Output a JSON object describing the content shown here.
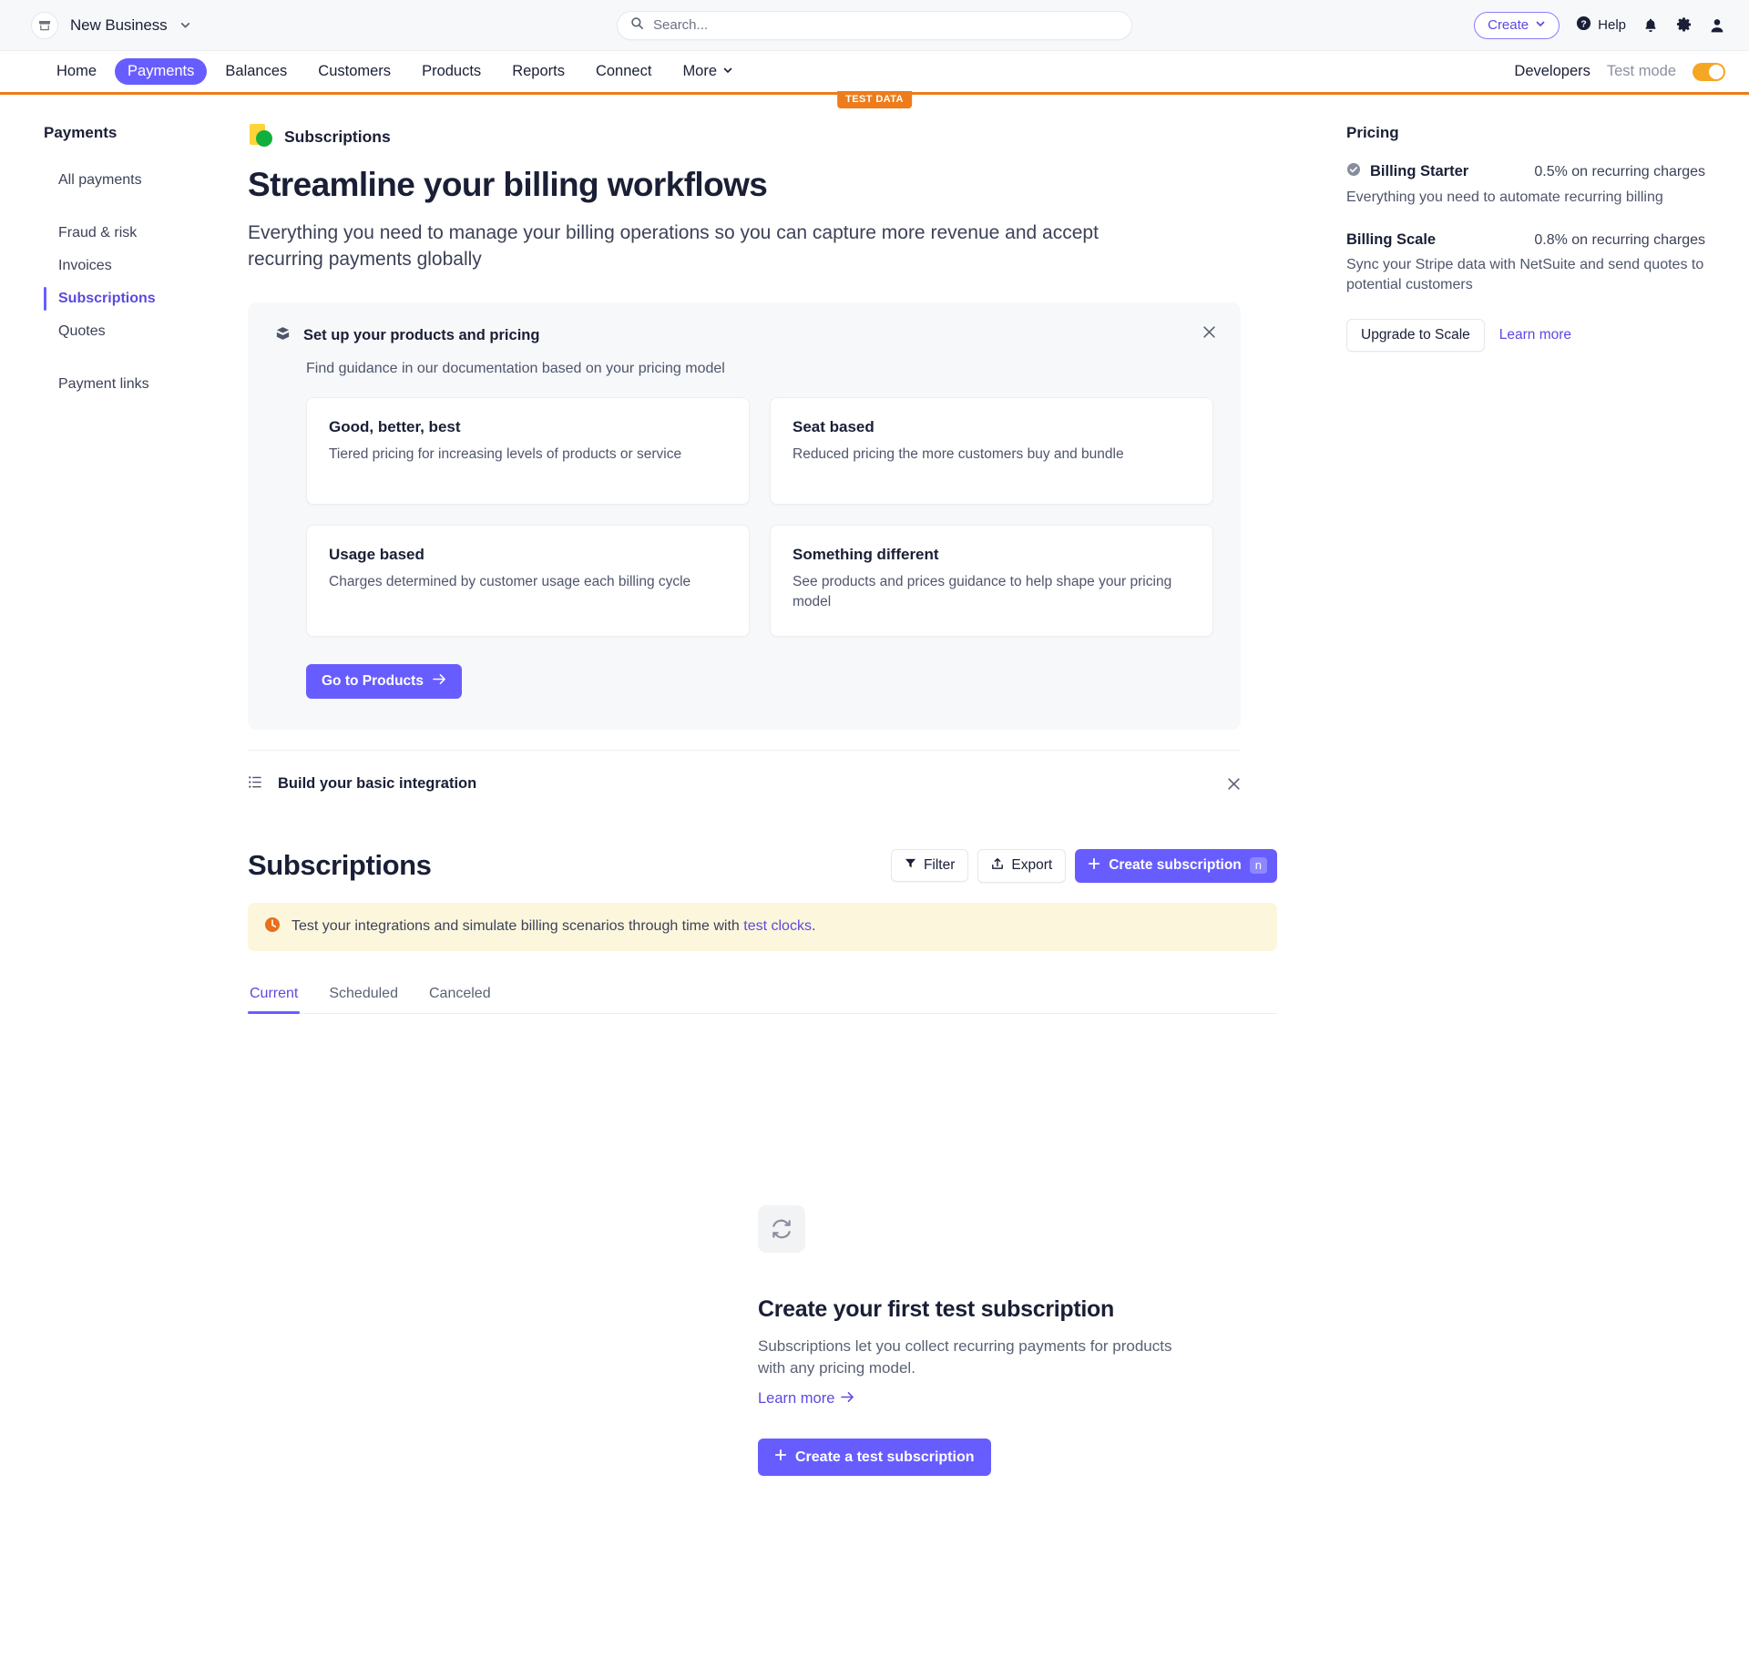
{
  "topbar": {
    "account_name": "New Business",
    "search_placeholder": "Search...",
    "search_value": "",
    "create_label": "Create",
    "help_label": "Help"
  },
  "nav": {
    "items": [
      {
        "label": "Home",
        "active": false
      },
      {
        "label": "Payments",
        "active": true
      },
      {
        "label": "Balances",
        "active": false
      },
      {
        "label": "Customers",
        "active": false
      },
      {
        "label": "Products",
        "active": false
      },
      {
        "label": "Reports",
        "active": false
      },
      {
        "label": "Connect",
        "active": false
      },
      {
        "label": "More",
        "active": false
      }
    ],
    "developers_label": "Developers",
    "test_mode_label": "Test mode",
    "test_data_badge": "TEST DATA",
    "accent_orange": "#ee7c1b",
    "accent_purple": "#675dff"
  },
  "sidebar": {
    "title": "Payments",
    "items": [
      {
        "label": "All payments",
        "active": false
      },
      {
        "label": "Fraud & risk",
        "active": false
      },
      {
        "label": "Invoices",
        "active": false
      },
      {
        "label": "Subscriptions",
        "active": true
      },
      {
        "label": "Quotes",
        "active": false
      },
      {
        "label": "Payment links",
        "active": false
      }
    ]
  },
  "hero": {
    "eyebrow": "Subscriptions",
    "title": "Streamline your billing workflows",
    "subtitle": "Everything you need to manage your billing operations so you can capture more revenue and accept recurring payments globally"
  },
  "setup_panel": {
    "title": "Set up your products and pricing",
    "subtitle": "Find guidance in our documentation based on your pricing model",
    "cards": [
      {
        "title": "Good, better, best",
        "desc": "Tiered pricing for increasing levels of products or service"
      },
      {
        "title": "Seat based",
        "desc": "Reduced pricing the more customers buy and bundle"
      },
      {
        "title": "Usage based",
        "desc": "Charges determined by customer usage each billing cycle"
      },
      {
        "title": "Something different",
        "desc": "See products and prices guidance to help shape your pricing model"
      }
    ],
    "cta_label": "Go to Products"
  },
  "build_row": {
    "title": "Build your basic integration"
  },
  "subscriptions": {
    "heading": "Subscriptions",
    "filter_label": "Filter",
    "export_label": "Export",
    "create_label": "Create subscription",
    "create_shortcut": "n",
    "notice_text_before": "Test your integrations and simulate billing scenarios through time with ",
    "notice_link": "test clocks",
    "notice_text_after": ".",
    "tabs": [
      {
        "label": "Current",
        "active": true
      },
      {
        "label": "Scheduled",
        "active": false
      },
      {
        "label": "Canceled",
        "active": false
      }
    ]
  },
  "empty_state": {
    "title": "Create your first test subscription",
    "desc": "Subscriptions let you collect recurring payments for products with any pricing model.",
    "learn_more": "Learn more",
    "cta_label": "Create a test subscription"
  },
  "pricing_rail": {
    "title": "Pricing",
    "plans": [
      {
        "name": "Billing Starter",
        "price": "0.5% on recurring charges",
        "desc": "Everything you need to automate recurring billing",
        "active": true
      },
      {
        "name": "Billing Scale",
        "price": "0.8% on recurring charges",
        "desc": "Sync your Stripe data with NetSuite and send quotes to potential customers",
        "active": false
      }
    ],
    "upgrade_label": "Upgrade to Scale",
    "learn_more_label": "Learn more"
  }
}
